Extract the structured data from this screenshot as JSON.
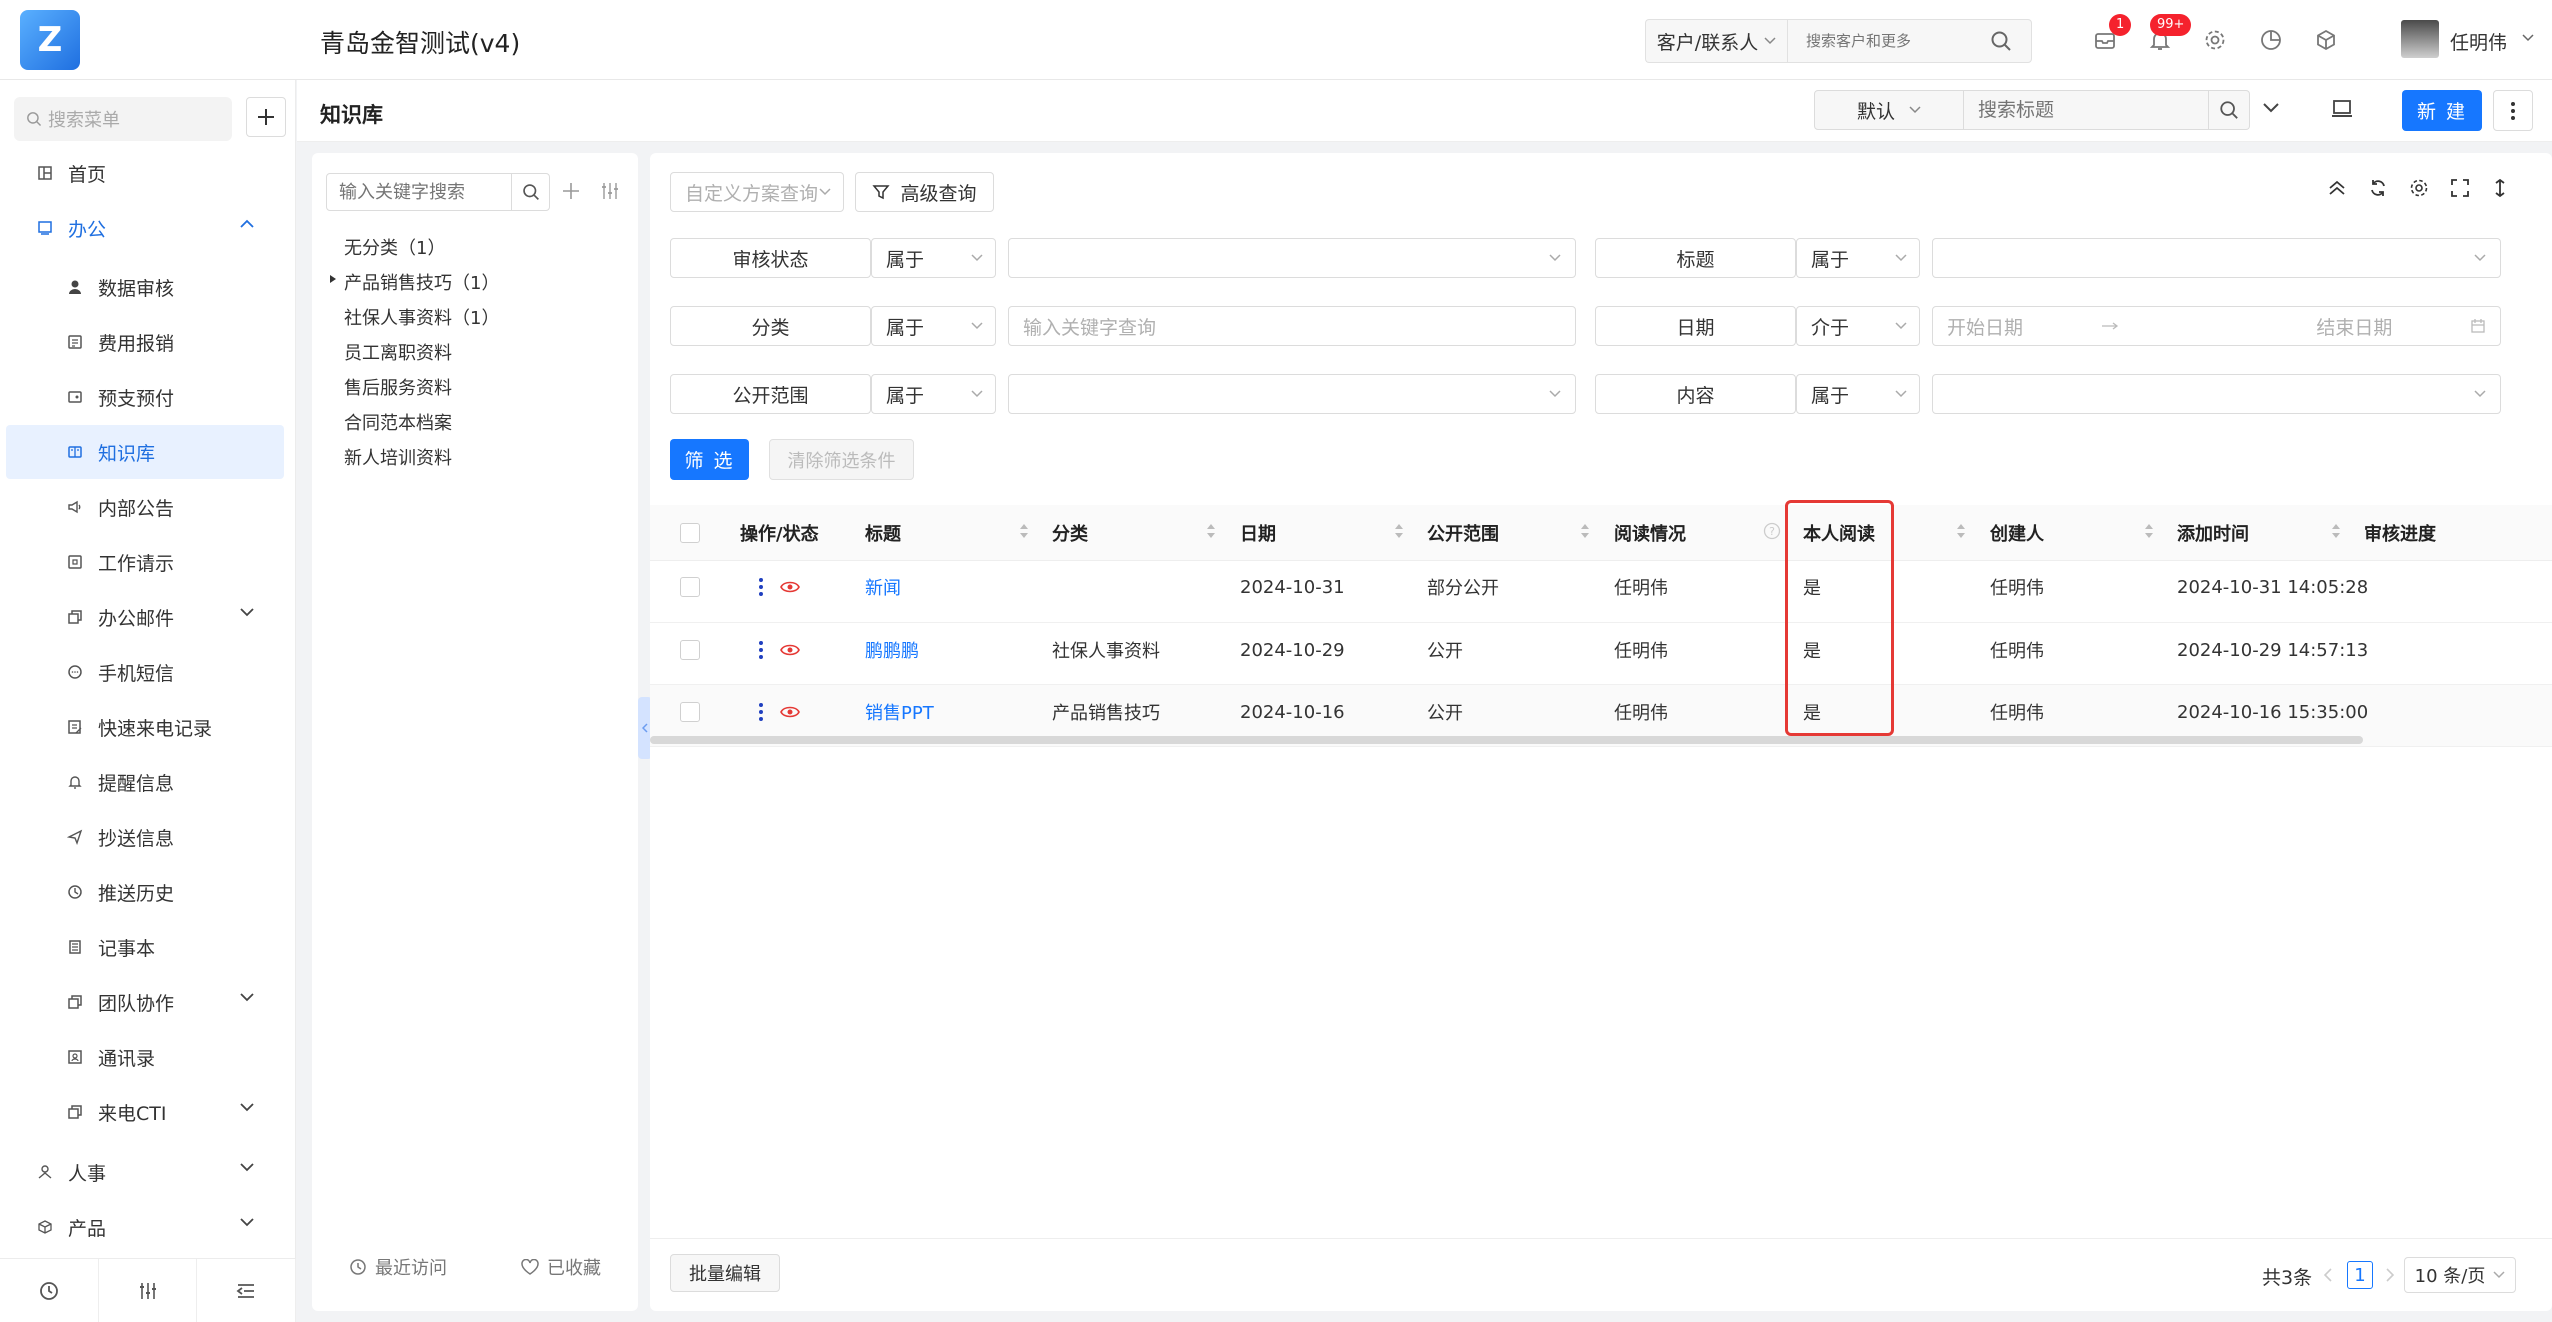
{
  "app": {
    "title": "青岛金智测试(v4)",
    "logo_text": "Z"
  },
  "topbar": {
    "customer_select": "客户/联系人",
    "search_placeholder": "搜索客户和更多",
    "mail_badge": "1",
    "notify_badge": "99+",
    "user_name": "任明伟"
  },
  "sidebar": {
    "search_placeholder": "搜索菜单",
    "items": [
      {
        "label": "首页",
        "icon": "home-icon"
      },
      {
        "label": "办公",
        "icon": "office-icon"
      },
      {
        "label": "数据审核",
        "icon": "user-icon"
      },
      {
        "label": "费用报销",
        "icon": "receipt-icon"
      },
      {
        "label": "预支预付",
        "icon": "wallet-icon"
      },
      {
        "label": "知识库",
        "icon": "book-icon"
      },
      {
        "label": "内部公告",
        "icon": "speaker-icon"
      },
      {
        "label": "工作请示",
        "icon": "doc-icon"
      },
      {
        "label": "办公邮件",
        "icon": "copy-icon"
      },
      {
        "label": "手机短信",
        "icon": "chat-icon"
      },
      {
        "label": "快速来电记录",
        "icon": "edit-icon"
      },
      {
        "label": "提醒信息",
        "icon": "bell-icon"
      },
      {
        "label": "抄送信息",
        "icon": "send-icon"
      },
      {
        "label": "推送历史",
        "icon": "clock-icon"
      },
      {
        "label": "记事本",
        "icon": "notebook-icon"
      },
      {
        "label": "团队协作",
        "icon": "copy-icon"
      },
      {
        "label": "通讯录",
        "icon": "contacts-icon"
      },
      {
        "label": "来电CTI",
        "icon": "copy-icon"
      },
      {
        "label": "人事",
        "icon": "hr-icon"
      },
      {
        "label": "产品",
        "icon": "box-icon"
      }
    ]
  },
  "header": {
    "page_title": "知识库",
    "view_select": "默认",
    "search_placeholder": "搜索标题",
    "new_label": "新 建"
  },
  "categories": {
    "search_placeholder": "输入关键字搜索",
    "items": [
      "无分类（1）",
      "产品销售技巧（1）",
      "社保人事资料（1）",
      "员工离职资料",
      "售后服务资料",
      "合同范本档案",
      "新人培训资料"
    ],
    "recent_label": "最近访问",
    "favorite_label": "已收藏"
  },
  "filters": {
    "scheme_placeholder": "自定义方案查询",
    "advanced_label": "高级查询",
    "rows": [
      {
        "label": "审核状态",
        "op": "属于",
        "placeholder": "",
        "label2": "标题",
        "op2": "属于",
        "placeholder2": ""
      },
      {
        "label": "分类",
        "op": "属于",
        "placeholder": "输入关键字查询",
        "label2": "日期",
        "op2": "介于",
        "start_placeholder": "开始日期",
        "end_placeholder": "结束日期"
      },
      {
        "label": "公开范围",
        "op": "属于",
        "placeholder": "",
        "label2": "内容",
        "op2": "属于",
        "placeholder2": ""
      }
    ],
    "filter_label": "筛 选",
    "clear_label": "清除筛选条件"
  },
  "table": {
    "columns": [
      "操作/状态",
      "标题",
      "分类",
      "日期",
      "公开范围",
      "阅读情况",
      "本人阅读",
      "创建人",
      "添加时间",
      "审核进度"
    ],
    "rows": [
      {
        "title": "新闻",
        "category": "",
        "date": "2024-10-31",
        "scope": "部分公开",
        "reading": "任明伟",
        "self_read": "是",
        "creator": "任明伟",
        "added": "2024-10-31 14:05:28",
        "progress": ""
      },
      {
        "title": "鹏鹏鹏",
        "category": "社保人事资料",
        "date": "2024-10-29",
        "scope": "公开",
        "reading": "任明伟",
        "self_read": "是",
        "creator": "任明伟",
        "added": "2024-10-29 14:57:13",
        "progress": ""
      },
      {
        "title": "销售PPT",
        "category": "产品销售技巧",
        "date": "2024-10-16",
        "scope": "公开",
        "reading": "任明伟",
        "self_read": "是",
        "creator": "任明伟",
        "added": "2024-10-16 15:35:00",
        "progress": ""
      }
    ]
  },
  "footer": {
    "batch_label": "批量编辑",
    "total_label": "共3条",
    "page": "1",
    "page_size": "10 条/页"
  },
  "colors": {
    "primary": "#1677ff",
    "highlight": "#e53935",
    "badge": "#f5222d"
  }
}
